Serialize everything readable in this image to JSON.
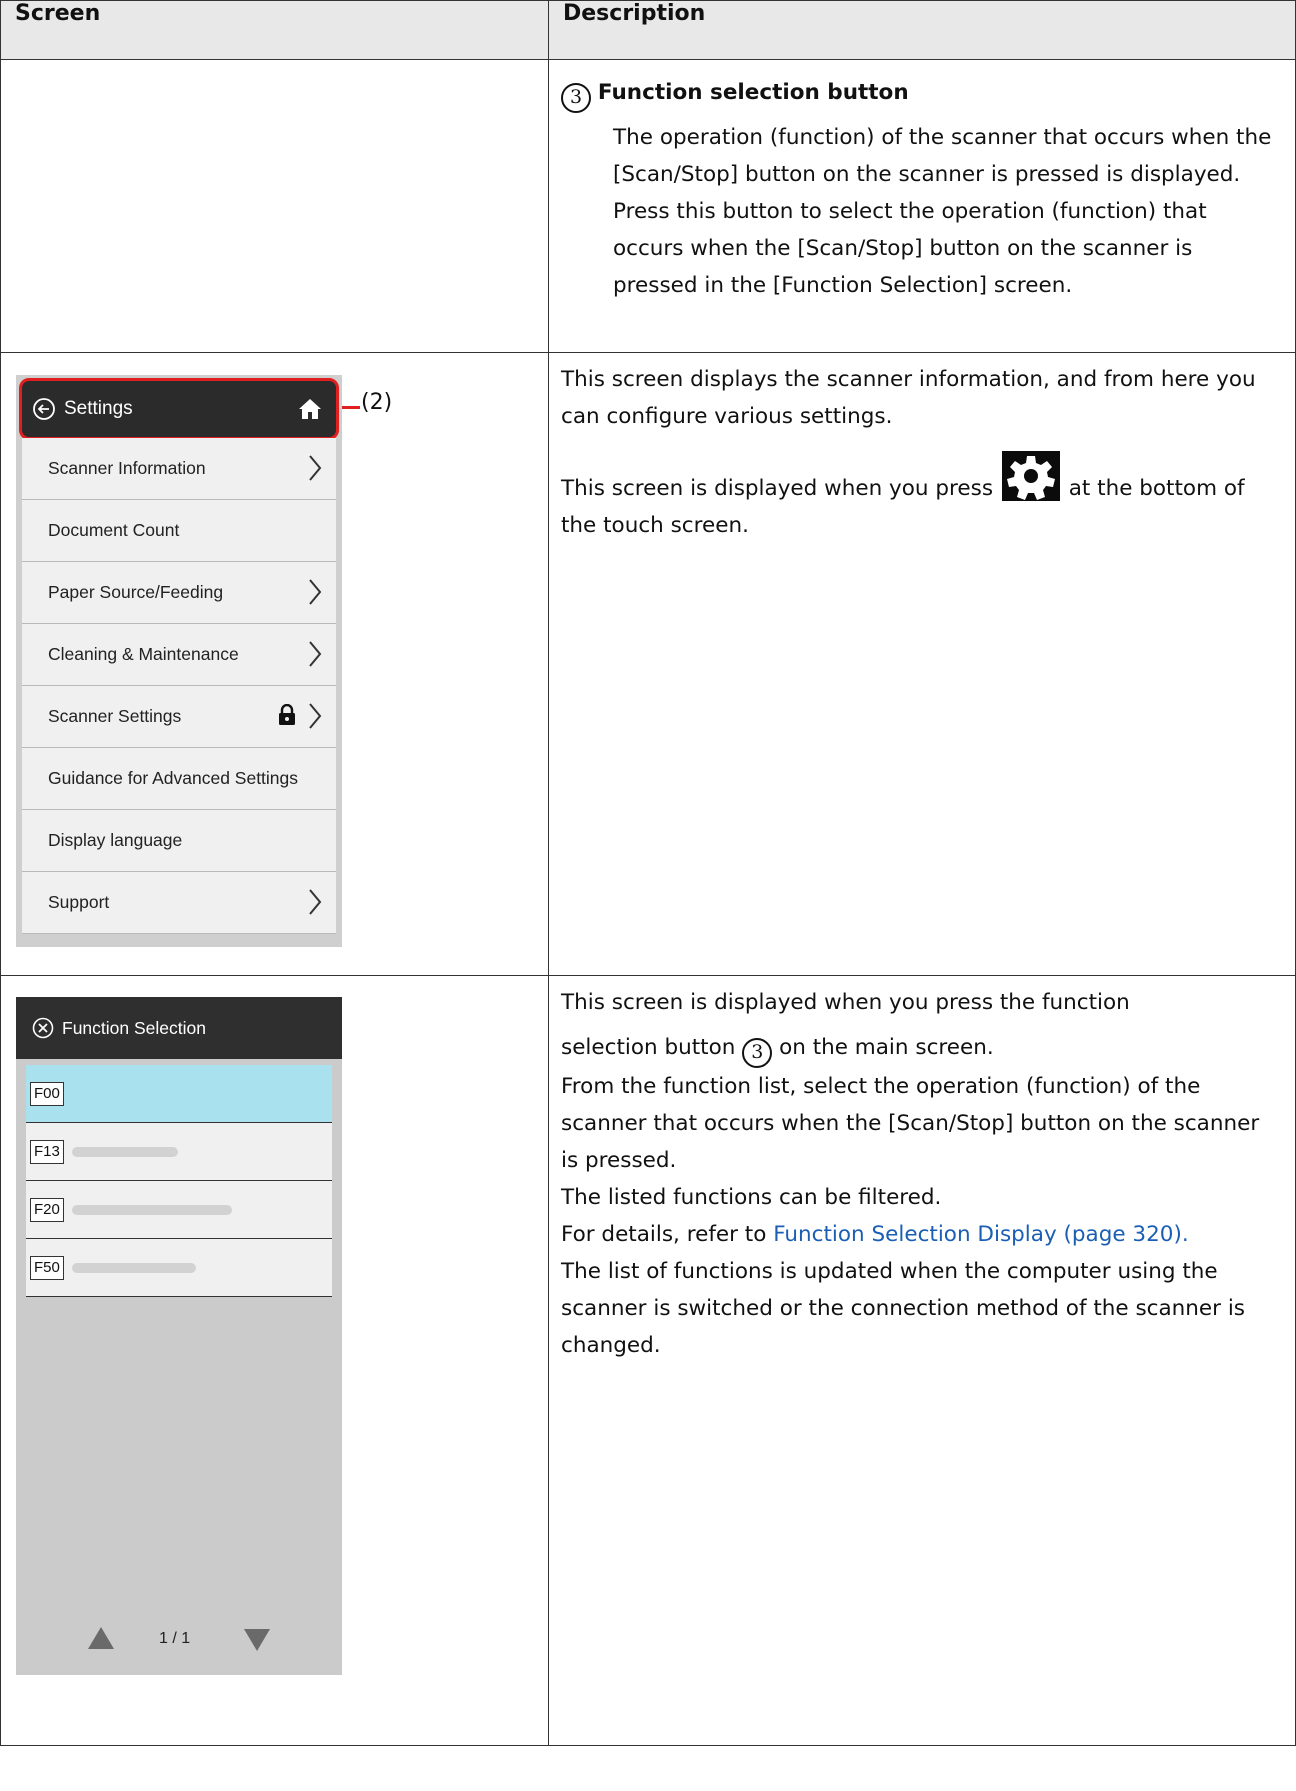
{
  "table": {
    "header_screen": "Screen",
    "header_description": "Description"
  },
  "row1": {
    "badge": "3",
    "title": "Function selection button",
    "para1": "The operation (function) of the scanner that occurs when the [Scan/Stop] button on the scanner is pressed is displayed.",
    "para2": "Press this button to select the operation (function) that occurs when the [Scan/Stop] button on the scanner is pressed in the [Function Selection] screen."
  },
  "row2": {
    "desc1": "This screen displays the scanner information, and from here you can configure various settings.",
    "desc2_before": "This screen is displayed when you press",
    "desc2_after": "at the bottom of the touch screen.",
    "callout": "(2)",
    "settings_screen": {
      "title": "Settings",
      "items": [
        {
          "label": "Scanner Information"
        },
        {
          "label": "Document Count"
        },
        {
          "label": "Paper Source/Feeding"
        },
        {
          "label": "Cleaning & Maintenance"
        },
        {
          "label": "Scanner Settings"
        },
        {
          "label": "Guidance for Advanced Settings"
        },
        {
          "label": "Display language"
        },
        {
          "label": "Support"
        }
      ]
    }
  },
  "row3": {
    "line1": "This screen is displayed when you press the function",
    "line2_before": "selection button",
    "badge": "3",
    "line2_after": "on the main screen.",
    "line3": "From the function list, select the operation (function) of the scanner that occurs when the [Scan/Stop] button on the scanner is pressed.",
    "line4": "The listed functions can be filtered.",
    "line5_before": "For details, refer to",
    "link": "Function Selection Display (page 320).",
    "line6": "The list of functions is updated when the computer using the scanner is switched or the connection method of the scanner is changed.",
    "function_screen": {
      "title": "Function Selection",
      "items": [
        {
          "code": "F00"
        },
        {
          "code": "F13"
        },
        {
          "code": "F20"
        },
        {
          "code": "F50"
        }
      ],
      "pager": "1 / 1"
    }
  },
  "colors": {
    "highlight": "#e02020",
    "link": "#1a5fb4",
    "selected_row": "#a9e1ee",
    "header_dark": "#2b2b2b"
  }
}
